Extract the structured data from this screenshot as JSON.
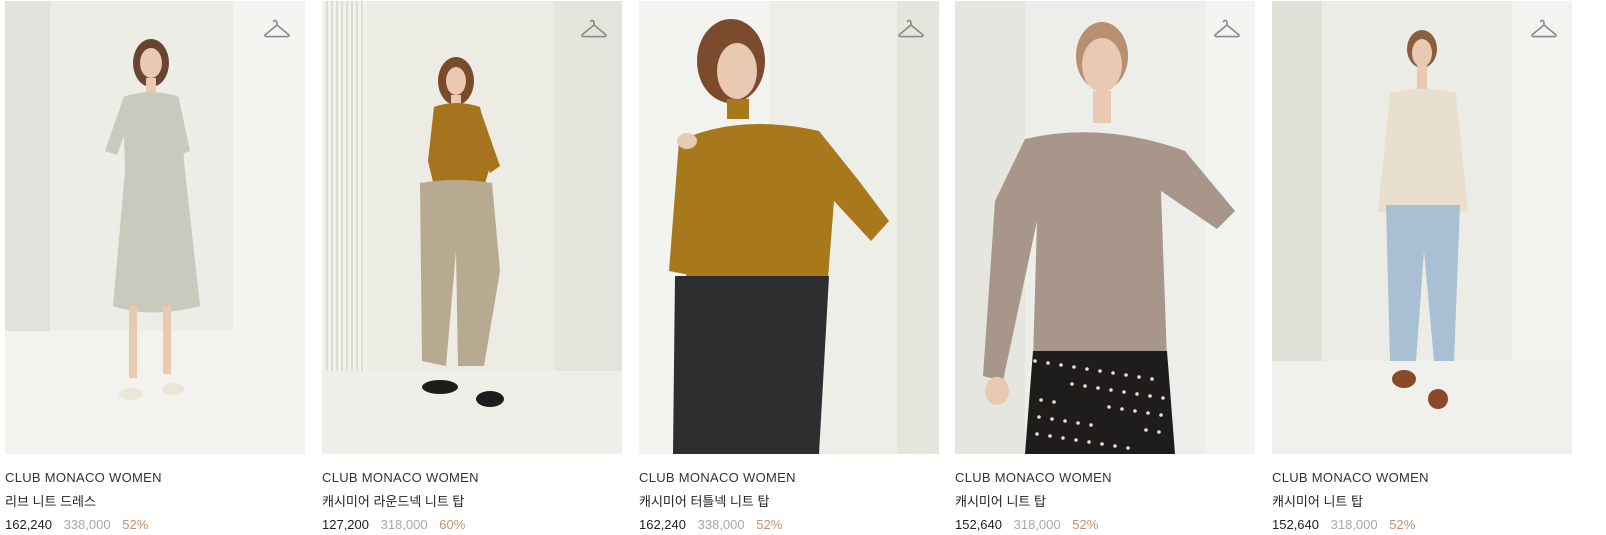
{
  "colors": {
    "discount": "#c8916b",
    "original_price": "#a8a8a8",
    "hanger_icon": "#8a8a8a"
  },
  "products": [
    {
      "brand": "CLUB MONACO WOMEN",
      "name": "리브 니트 드레스",
      "price": "162,240",
      "original_price": "338,000",
      "discount": "52%",
      "icon": "hanger-icon",
      "image": {
        "garment": "light grey ribbed knit midi dress",
        "top_color": "#c9cabd",
        "bottom_color": "#c9cabd",
        "wall": "#ecede7"
      }
    },
    {
      "brand": "CLUB MONACO WOMEN",
      "name": "캐시미어 라운드넥 니트 탑",
      "price": "127,200",
      "original_price": "318,000",
      "discount": "60%",
      "icon": "hanger-icon",
      "image": {
        "garment": "mustard round-neck knit top with beige pants",
        "top_color": "#a6741e",
        "bottom_color": "#b8aa90",
        "wall": "#ecebe4"
      }
    },
    {
      "brand": "CLUB MONACO WOMEN",
      "name": "캐시미어 터틀넥 니트 탑",
      "price": "162,240",
      "original_price": "338,000",
      "discount": "52%",
      "icon": "hanger-icon",
      "image": {
        "garment": "mustard turtleneck knit top with black jeans",
        "top_color": "#a8781c",
        "bottom_color": "#2e2e30",
        "wall": "#eeeee8"
      }
    },
    {
      "brand": "CLUB MONACO WOMEN",
      "name": "캐시미어 니트 탑",
      "price": "152,640",
      "original_price": "318,000",
      "discount": "52%",
      "icon": "hanger-icon",
      "image": {
        "garment": "taupe knit top with floral skirt",
        "top_color": "#a8968a",
        "bottom_color": "#1f1d1c",
        "wall": "#ededea"
      }
    },
    {
      "brand": "CLUB MONACO WOMEN",
      "name": "캐시미어 니트 탑",
      "price": "152,640",
      "original_price": "318,000",
      "discount": "52%",
      "icon": "hanger-icon",
      "image": {
        "garment": "cream knit top with light blue jeans",
        "top_color": "#e8e0cc",
        "bottom_color": "#a9bfd3",
        "wall": "#ecece6"
      }
    }
  ]
}
